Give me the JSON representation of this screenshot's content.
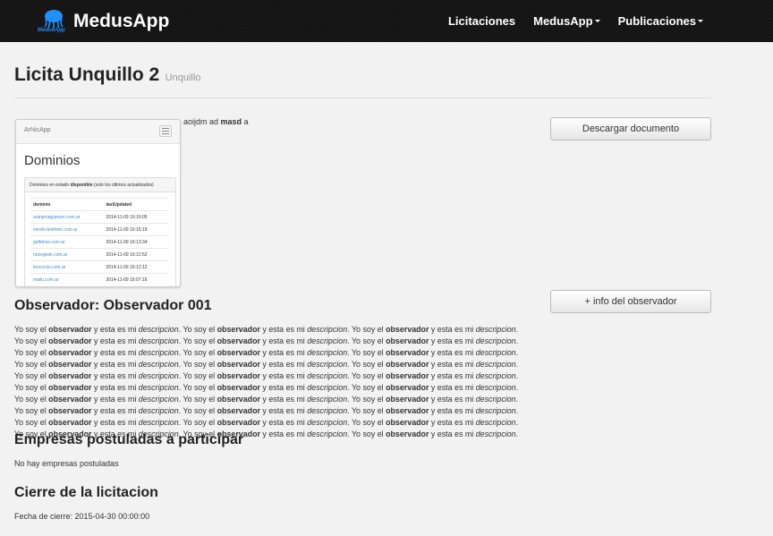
{
  "navbar": {
    "brand": "MedusApp",
    "logo_text": "MedusApp",
    "items": [
      {
        "label": "Licitaciones",
        "dropdown": false
      },
      {
        "label": "MedusApp",
        "dropdown": true
      },
      {
        "label": "Publicaciones",
        "dropdown": true
      }
    ]
  },
  "header": {
    "title": "Licita Unquillo 2",
    "subtitle": "Unquillo"
  },
  "thumbnail": {
    "brand": "ArNicApp",
    "heading": "Dominios",
    "panel_prefix": "Dominios en estado ",
    "panel_bold": "disponible",
    "panel_suffix": " (solo los últimos actualizados)",
    "columns": [
      "dominio",
      "lastUpdated"
    ],
    "rows": [
      [
        "aranjeragypsum.com.ar",
        "2014-11-09 16:16:05"
      ],
      [
        "vendo-telefono.com.ar",
        "2014-11-09 16:15:19"
      ],
      [
        "golfdrive.com.ar",
        "2014-11-09 16:13:34"
      ],
      [
        "nosogeek.com.ar",
        "2014-11-09 16:12:52"
      ],
      [
        "leucocito.com.ar",
        "2014-11-09 16:12:12"
      ],
      [
        "mailu.com.ar",
        "2014-11-09 16:07:16"
      ]
    ]
  },
  "description": {
    "pre": "aoijdm ad ",
    "bold": "masd",
    "post": " a"
  },
  "buttons": {
    "download": "Descargar documento",
    "info": "+ info del observador"
  },
  "observer": {
    "title": "Observador: Observador 001",
    "phrase_start": "Yo soy el ",
    "phrase_bold": "observador",
    "phrase_mid": "  y esta es mi ",
    "phrase_italic": "descripcion",
    "phrase_end": ".",
    "repeat": 30
  },
  "empresas": {
    "title": "Empresas postuladas a participar",
    "text": "No hay empresas postuladas"
  },
  "cierre": {
    "title": "Cierre de la licitacion",
    "text": "Fecha de cierre: 2015-04-30 00:00:00"
  },
  "colors": {
    "navbar": "#111111",
    "link": "#428bca",
    "logo": "#1e90ff"
  }
}
